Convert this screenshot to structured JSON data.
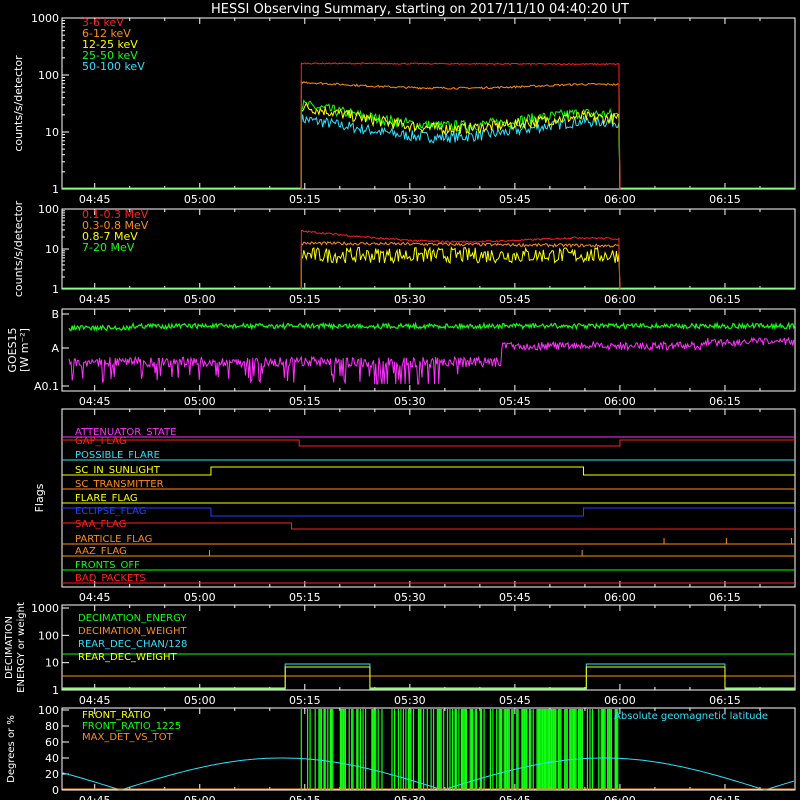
{
  "title": "HESSI Observing Summary, starting on 2017/11/10 04:40:20 UT",
  "time_ticks": [
    "04:45",
    "05:00",
    "05:15",
    "05:30",
    "05:45",
    "06:00",
    "06:15"
  ],
  "tick_minutes": [
    285,
    300,
    315,
    330,
    345,
    360,
    375
  ],
  "colors": {
    "red": "#ff2020",
    "orange": "#ff8c1a",
    "yellow": "#ffff00",
    "green": "#10ff10",
    "cyan": "#30e0ff",
    "magenta": "#ff30ff",
    "blue": "#2040ff",
    "white": "#ffffff"
  },
  "chart_data": [
    {
      "type": "line",
      "id": "low_energy",
      "ylabel": "counts/s/detector",
      "yscale": "log",
      "ylim": [
        1,
        1000
      ],
      "yticks": [
        "1",
        "10",
        "100",
        "1000"
      ],
      "xlim_minutes": [
        280.33,
        385
      ],
      "series": [
        {
          "name": "3-6 keV",
          "color": "red",
          "start": 314.5,
          "end": 360,
          "level_start": 160,
          "level_end": 155
        },
        {
          "name": "6-12 keV",
          "color": "orange",
          "start": 314.5,
          "end": 360,
          "level_start": 75,
          "level_end": 68
        },
        {
          "name": "12-25 keV",
          "color": "yellow",
          "start": 314.5,
          "end": 360,
          "level_start": 28,
          "level_end": 17
        },
        {
          "name": "25-50 keV",
          "color": "green",
          "start": 314.5,
          "end": 360,
          "level_start": 30,
          "level_end": 20
        },
        {
          "name": "50-100 keV",
          "color": "cyan",
          "start": 314.5,
          "end": 360,
          "level_start": 17,
          "level_end": 15
        }
      ]
    },
    {
      "type": "line",
      "id": "high_energy",
      "ylabel": "counts/s/detector",
      "yscale": "log",
      "ylim": [
        1,
        100
      ],
      "yticks": [
        "1",
        "10",
        "100"
      ],
      "series": [
        {
          "name": "0.1-0.3 MeV",
          "color": "red",
          "level_start": 28,
          "level_end": 18
        },
        {
          "name": "0.3-0.8 MeV",
          "color": "orange",
          "level_start": 14,
          "level_end": 12
        },
        {
          "name": "0.8-7 MeV",
          "color": "yellow",
          "level_start": 7,
          "level_end": 7
        },
        {
          "name": "7-20 MeV",
          "color": "green",
          "level_start": 1,
          "level_end": 1
        }
      ]
    },
    {
      "type": "line",
      "id": "goes",
      "ylabel": "GOES15",
      "yunit": "[W m⁻²]",
      "yticks": [
        "A0.1",
        "A",
        "B"
      ]
    },
    {
      "type": "table",
      "id": "flags",
      "ylabel": "Flags",
      "flags": [
        {
          "name": "ATTENUATOR_STATE",
          "color": "magenta"
        },
        {
          "name": "GAP_FLAG",
          "color": "red"
        },
        {
          "name": "POSSIBLE_FLARE",
          "color": "cyan"
        },
        {
          "name": "SC_IN_SUNLIGHT",
          "color": "yellow"
        },
        {
          "name": "SC_TRANSMITTER",
          "color": "orange"
        },
        {
          "name": "FLARE_FLAG",
          "color": "yellow"
        },
        {
          "name": "ECLIPSE_FLAG",
          "color": "blue"
        },
        {
          "name": "SAA_FLAG",
          "color": "red"
        },
        {
          "name": "PARTICLE_FLAG",
          "color": "orange"
        },
        {
          "name": "AAZ_FLAG",
          "color": "orange"
        },
        {
          "name": "FRONTS_OFF",
          "color": "green"
        },
        {
          "name": "BAD_PACKETS",
          "color": "red"
        }
      ]
    },
    {
      "type": "line",
      "id": "decimation",
      "ylabel_lines": [
        "DECIMATION",
        "ENERGY or weight"
      ],
      "yticks": [
        "1",
        "10",
        "100",
        "1000"
      ],
      "series": [
        {
          "name": "DECIMATION_ENERGY",
          "color": "green"
        },
        {
          "name": "DECIMATION_WEIGHT",
          "color": "orange"
        },
        {
          "name": "REAR_DEC_CHAN/128",
          "color": "cyan"
        },
        {
          "name": "REAR_DEC_WEIGHT",
          "color": "yellow"
        }
      ]
    },
    {
      "type": "line",
      "id": "ratios",
      "ylabel": "Degrees or %",
      "yticks": [
        "0",
        "20",
        "40",
        "60",
        "80",
        "100"
      ],
      "series": [
        {
          "name": "FRONT_RATIO",
          "color": "yellow"
        },
        {
          "name": "FRONT_RATIO_1225",
          "color": "green"
        },
        {
          "name": "MAX_DET_VS_TOT",
          "color": "orange"
        },
        {
          "name": "Absolute geomagnetic latitude",
          "color": "cyan"
        }
      ]
    }
  ]
}
